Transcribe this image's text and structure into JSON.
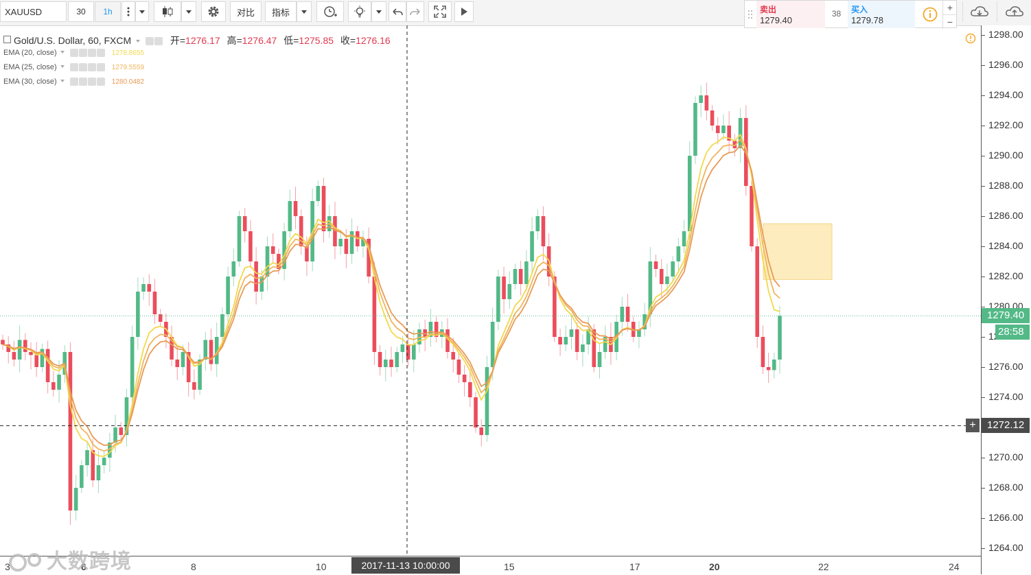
{
  "toolbar": {
    "symbol": "XAUUSD",
    "interval": "30",
    "resolution": "1h",
    "compare_label": "对比",
    "indicators_label": "指标",
    "icons": [
      "more-vert-icon",
      "candles-icon",
      "gear-icon",
      "alert-icon",
      "idea-icon",
      "undo-icon",
      "redo-icon",
      "fullscreen-icon",
      "play-icon"
    ]
  },
  "trade": {
    "sell_label": "卖出",
    "sell_price": "1279.40",
    "spread": "38",
    "buy_label": "买入",
    "buy_price": "1279.78",
    "sell_color": "#e0394f",
    "buy_color": "#2196f3"
  },
  "legend": {
    "title": "Gold/U.S. Dollar, 60, FXCM",
    "open_label": "开=",
    "open_value": "1276.17",
    "high_label": "高=",
    "high_value": "1276.47",
    "low_label": "低=",
    "low_value": "1275.85",
    "close_label": "收=",
    "close_value": "1276.16",
    "indicators": [
      {
        "name": "EMA (20, close)",
        "value": "1278.8655",
        "color": "#f2d84a"
      },
      {
        "name": "EMA (25, close)",
        "value": "1279.5559",
        "color": "#f0b45c"
      },
      {
        "name": "EMA (30, close)",
        "value": "1280.0482",
        "color": "#e89a55"
      }
    ]
  },
  "price_axis": {
    "ticks": [
      "1298.00",
      "1296.00",
      "1294.00",
      "1292.00",
      "1290.00",
      "1288.00",
      "1286.00",
      "1284.00",
      "1282.00",
      "1280.00",
      "1278.00",
      "1276.00",
      "1274.00",
      "1272.00",
      "1270.00",
      "1268.00",
      "1266.00",
      "1264.00"
    ],
    "last_price": "1279.40",
    "countdown": "28:58",
    "crosshair_price": "1272.12"
  },
  "time_axis": {
    "ticks": [
      "3",
      "6",
      "8",
      "10",
      "15",
      "17",
      "20",
      "22",
      "24"
    ],
    "crosshair_date": "2017-11-13 10:00:00"
  },
  "colors": {
    "up": "#53b987",
    "down": "#eb4d5c",
    "ema20": "#f2d84a",
    "ema25": "#f0b45c",
    "ema30": "#e89a55",
    "highlight": "#fde9b3"
  },
  "watermark": "大数跨境",
  "chart_data": {
    "type": "candlestick",
    "title": "Gold/U.S. Dollar, 60, FXCM",
    "ylim": [
      1263,
      1299
    ],
    "x_tick_labels": [
      "3",
      "6",
      "8",
      "10",
      "15",
      "17",
      "20",
      "22",
      "24"
    ],
    "close_path": [
      1277.5,
      1277,
      1276.5,
      1277.8,
      1277,
      1276.8,
      1276,
      1277.2,
      1275,
      1274.5,
      1275.5,
      1277,
      1266.5,
      1268,
      1269.5,
      1270.5,
      1268.5,
      1269.5,
      1270,
      1271,
      1272,
      1271.5,
      1274,
      1278,
      1281,
      1281.5,
      1281,
      1279.5,
      1279,
      1278,
      1276.5,
      1276,
      1277,
      1275,
      1274.5,
      1276.5,
      1277.8,
      1276.2,
      1278,
      1279.5,
      1282,
      1283,
      1286,
      1285,
      1283,
      1281,
      1282,
      1284,
      1283.5,
      1282.5,
      1285,
      1287,
      1286,
      1284,
      1283,
      1287,
      1288,
      1285,
      1286,
      1284,
      1284.5,
      1283.5,
      1285,
      1284,
      1284.5,
      1282,
      1277,
      1276,
      1276.5,
      1276,
      1277,
      1277.5,
      1276.5,
      1277.5,
      1278.5,
      1278,
      1279,
      1278,
      1278.5,
      1277,
      1276.5,
      1275.5,
      1275,
      1274,
      1272,
      1271.5,
      1276,
      1279,
      1282,
      1280.5,
      1281.5,
      1282.5,
      1281.5,
      1283,
      1285,
      1286,
      1284,
      1282,
      1278,
      1277.5,
      1278,
      1278.5,
      1277,
      1277.5,
      1278.5,
      1276,
      1277,
      1278,
      1277,
      1279,
      1280,
      1279,
      1278,
      1278.5,
      1279.5,
      1283,
      1282.5,
      1281.5,
      1282,
      1283,
      1284,
      1285,
      1290,
      1293.5,
      1294,
      1293,
      1292,
      1291.5,
      1292,
      1291,
      1290.5,
      1292.5,
      1288,
      1284,
      1278,
      1276,
      1275.8,
      1276.5,
      1279.4
    ],
    "ema_values": [
      {
        "name": "EMA (20, close)",
        "value": 1278.8655
      },
      {
        "name": "EMA (25, close)",
        "value": 1279.5559
      },
      {
        "name": "EMA (30, close)",
        "value": 1280.0482
      }
    ],
    "last_price": 1279.4,
    "crosshair_price": 1272.12,
    "highlight_zone": [
      1281.8,
      1285.5
    ]
  }
}
